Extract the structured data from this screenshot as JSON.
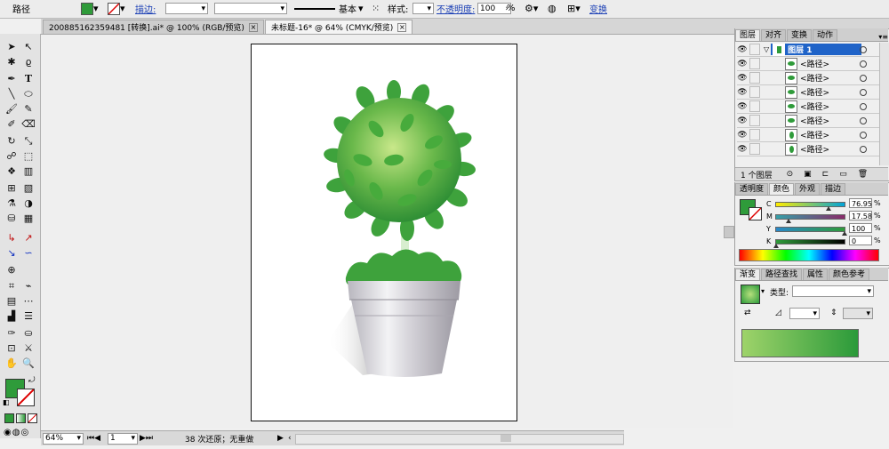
{
  "control_bar": {
    "object_type": "路径",
    "fill_color": "#2f9b3a",
    "stroke_label": "描边:",
    "stroke_style": "基本",
    "style_label": "样式:",
    "opacity_label": "不透明度:",
    "opacity_value": "100",
    "opacity_unit": "%",
    "transform_label": "变换"
  },
  "tabs": [
    {
      "label": "200885162359481 [转换].ai* @ 100% (RGB/预览)",
      "active": false
    },
    {
      "label": "未标题-16* @ 64% (CMYK/预览)",
      "active": true
    }
  ],
  "status_bar": {
    "zoom": "64%",
    "page": "1",
    "undo_text": "38 次还原；无重做"
  },
  "layers_panel": {
    "tabs": [
      "图层",
      "对齐",
      "变换",
      "动作"
    ],
    "layer_name": "图层 1",
    "rows": [
      "<路径>",
      "<路径>",
      "<路径>",
      "<路径>",
      "<路径>",
      "<路径>",
      "<路径>"
    ],
    "footer": "1 个图层"
  },
  "color_panel": {
    "tabs": [
      "透明度",
      "颜色",
      "外观",
      "描边"
    ],
    "channels": [
      {
        "label": "C",
        "value": "76.95",
        "fraction": 0.77
      },
      {
        "label": "M",
        "value": "17.58",
        "fraction": 0.18
      },
      {
        "label": "Y",
        "value": "100",
        "fraction": 1.0
      },
      {
        "label": "K",
        "value": "0",
        "fraction": 0.0
      }
    ],
    "unit": "%",
    "fill_color": "#2f9b3a"
  },
  "gradient_panel": {
    "tabs": [
      "渐变",
      "路径查找",
      "属性",
      "颜色参考"
    ],
    "type_label": "类型:",
    "start_color": "#9ed36a",
    "end_color": "#2b9a3a"
  },
  "tools": [
    "selection",
    "direct-selection",
    "magic-wand",
    "lasso",
    "pen",
    "type",
    "line",
    "ellipse",
    "paintbrush",
    "pencil",
    "blob-brush",
    "eraser",
    "rotate",
    "scale",
    "warp",
    "free-transform",
    "symbol-sprayer",
    "column-graph",
    "mesh",
    "gradient",
    "eyedropper",
    "blend",
    "live-paint-bucket",
    "live-paint-selection",
    "artboard",
    "slice",
    "hand",
    "zoom"
  ]
}
